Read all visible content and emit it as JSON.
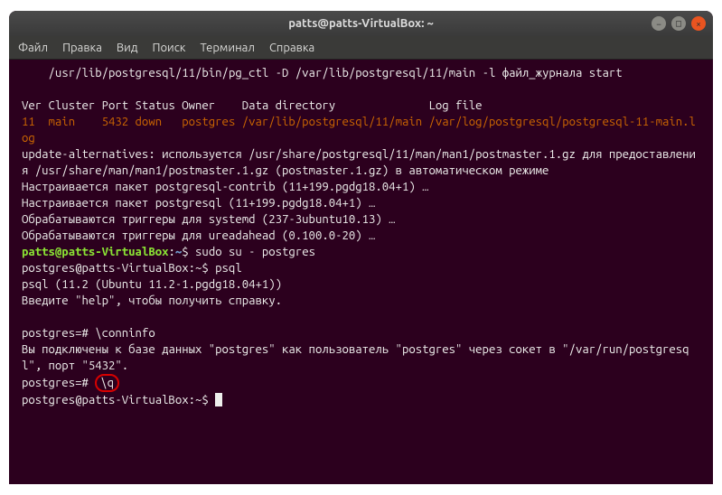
{
  "window": {
    "title": "patts@patts-VirtualBox: ~"
  },
  "menubar": {
    "file": "Файл",
    "edit": "Правка",
    "view": "Вид",
    "search": "Поиск",
    "terminal": "Терминал",
    "help": "Справка"
  },
  "term": {
    "l1": "    /usr/lib/postgresql/11/bin/pg_ctl -D /var/lib/postgresql/11/main -l файл_журнала start",
    "l2": "",
    "l3": "Ver Cluster Port Status Owner    Data directory              Log file",
    "l4a": "11  main    5432 ",
    "l4b": "down",
    "l4c": "   postgres /var/lib/postgresql/11/main /var/log/postgresql/postgresql-11-main.log",
    "l5": "update-alternatives: используется /usr/share/postgresql/11/man/man1/postmaster.1.gz для предоставления /usr/share/man/man1/postmaster.1.gz (postmaster.1.gz) в автоматическом режиме",
    "l6": "Настраивается пакет postgresql-contrib (11+199.pgdg18.04+1) …",
    "l7": "Настраивается пакет postgresql (11+199.pgdg18.04+1) …",
    "l8": "Обрабатываются триггеры для systemd (237-3ubuntu10.13) …",
    "l9": "Обрабатываются триггеры для ureadahead (0.100.0-20) …",
    "p1_user": "patts@patts-VirtualBox",
    "p1_path": "~",
    "p1_cmd": "sudo su - postgres",
    "l10": "postgres@patts-VirtualBox:~$ psql",
    "l11": "psql (11.2 (Ubuntu 11.2-1.pgdg18.04+1))",
    "l12": "Введите \"help\", чтобы получить справку.",
    "l13": "",
    "l14": "postgres=# \\conninfo",
    "l15": "Вы подключены к базе данных \"postgres\" как пользователь \"postgres\" через сокет в \"/var/run/postgresql\", порт \"5432\".",
    "l16_prompt": "postgres=# ",
    "l16_cmd": "\\q",
    "l17": "postgres@patts-VirtualBox:~$ "
  },
  "win_buttons": {
    "min": "−",
    "max": "□",
    "close": "×"
  }
}
